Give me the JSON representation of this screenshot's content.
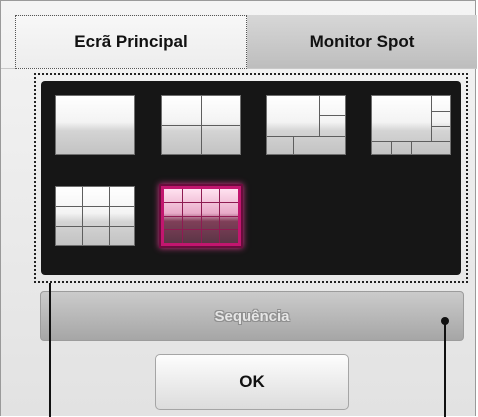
{
  "tabs": [
    {
      "label": "Ecrã Principal",
      "active": true
    },
    {
      "label": "Monitor Spot",
      "active": false
    }
  ],
  "layouts": [
    {
      "id": "1-split",
      "selected": false
    },
    {
      "id": "4-split",
      "selected": false
    },
    {
      "id": "1-plus-6-split",
      "selected": false
    },
    {
      "id": "1-plus-8-split",
      "selected": false
    },
    {
      "id": "9-split",
      "selected": false
    },
    {
      "id": "16-split",
      "selected": true
    }
  ],
  "sequence_button": {
    "label": "Sequência",
    "enabled": false
  },
  "ok_button": {
    "label": "OK"
  },
  "colors": {
    "selection_accent": "#c2166f",
    "panel_background": "#161616"
  }
}
